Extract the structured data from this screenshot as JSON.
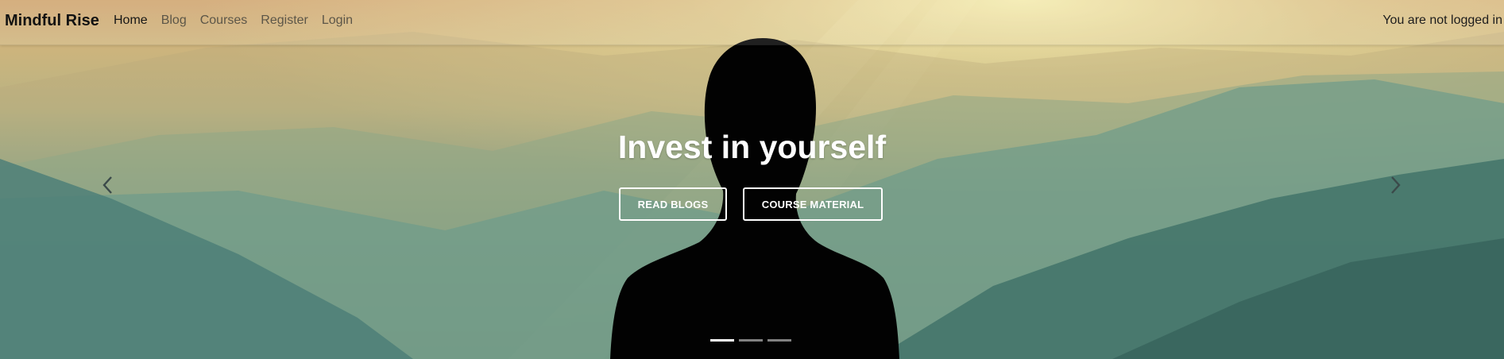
{
  "navbar": {
    "brand": "Mindful Rise",
    "links": [
      {
        "label": "Home",
        "active": true
      },
      {
        "label": "Blog",
        "active": false
      },
      {
        "label": "Courses",
        "active": false
      },
      {
        "label": "Register",
        "active": false
      },
      {
        "label": "Login",
        "active": false
      }
    ],
    "login_status": "You are not logged in"
  },
  "hero": {
    "title": "Invest in yourself",
    "read_blogs_label": "READ BLOGS",
    "course_material_label": "COURSE MATERIAL",
    "prev_icon": "chevron-left-icon",
    "next_icon": "chevron-right-icon",
    "slide_count": 3,
    "active_slide": 1
  },
  "colors": {
    "text_white": "#ffffff",
    "brand_text": "#121212",
    "nav_text": "#5c5648",
    "silhouette": "#000000"
  }
}
